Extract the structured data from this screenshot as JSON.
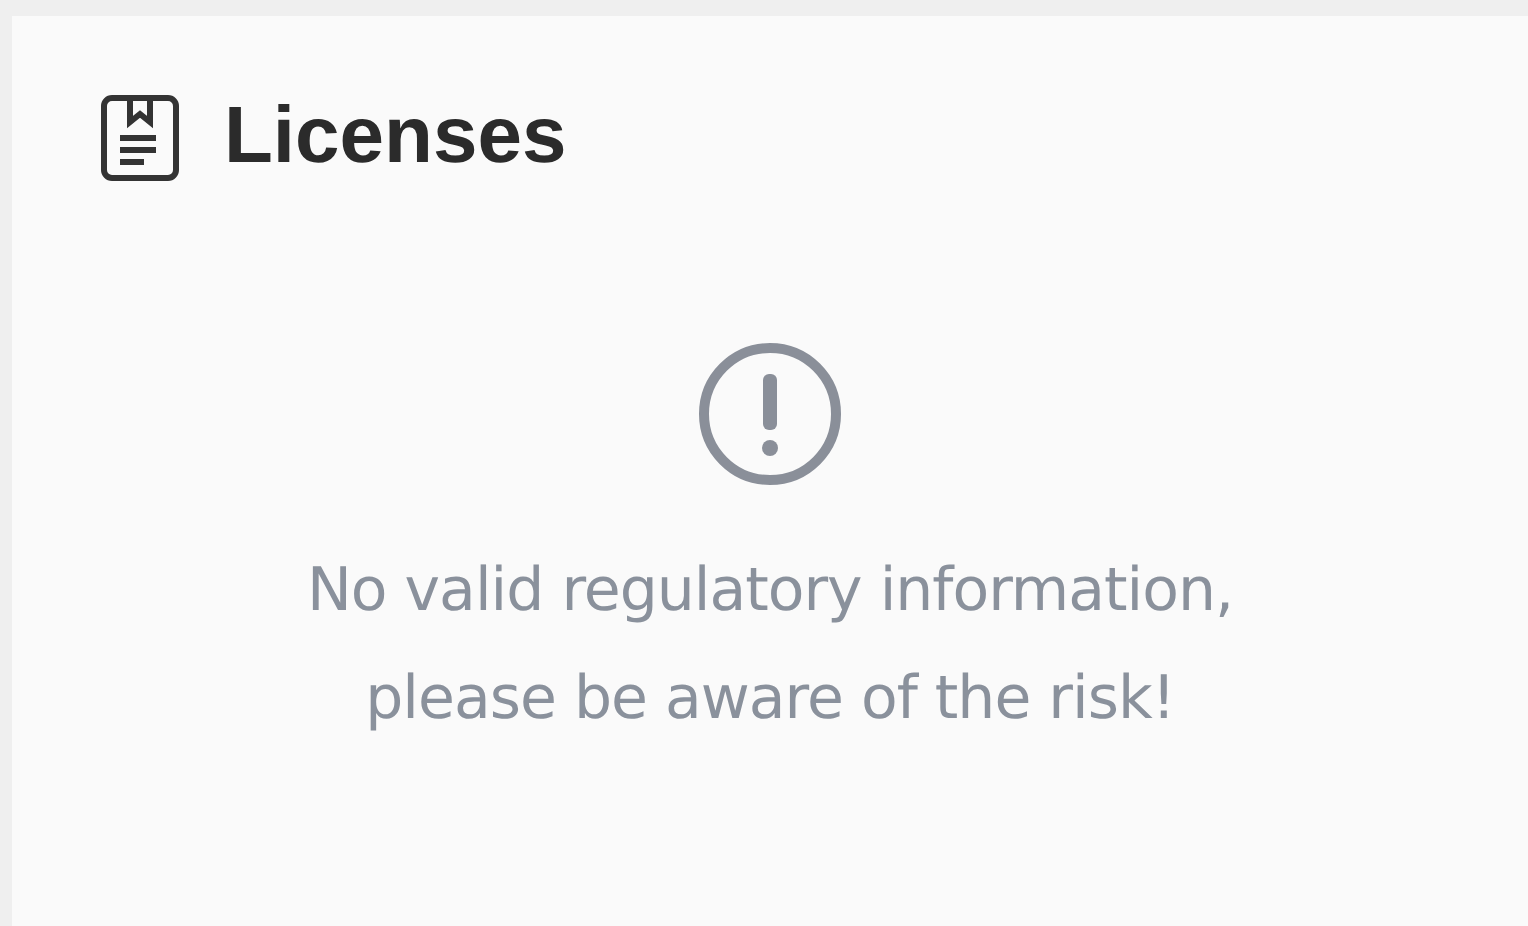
{
  "section": {
    "title": "Licenses"
  },
  "notice": {
    "lines": [
      "No valid regulatory information,",
      "please be aware of the risk!"
    ]
  }
}
